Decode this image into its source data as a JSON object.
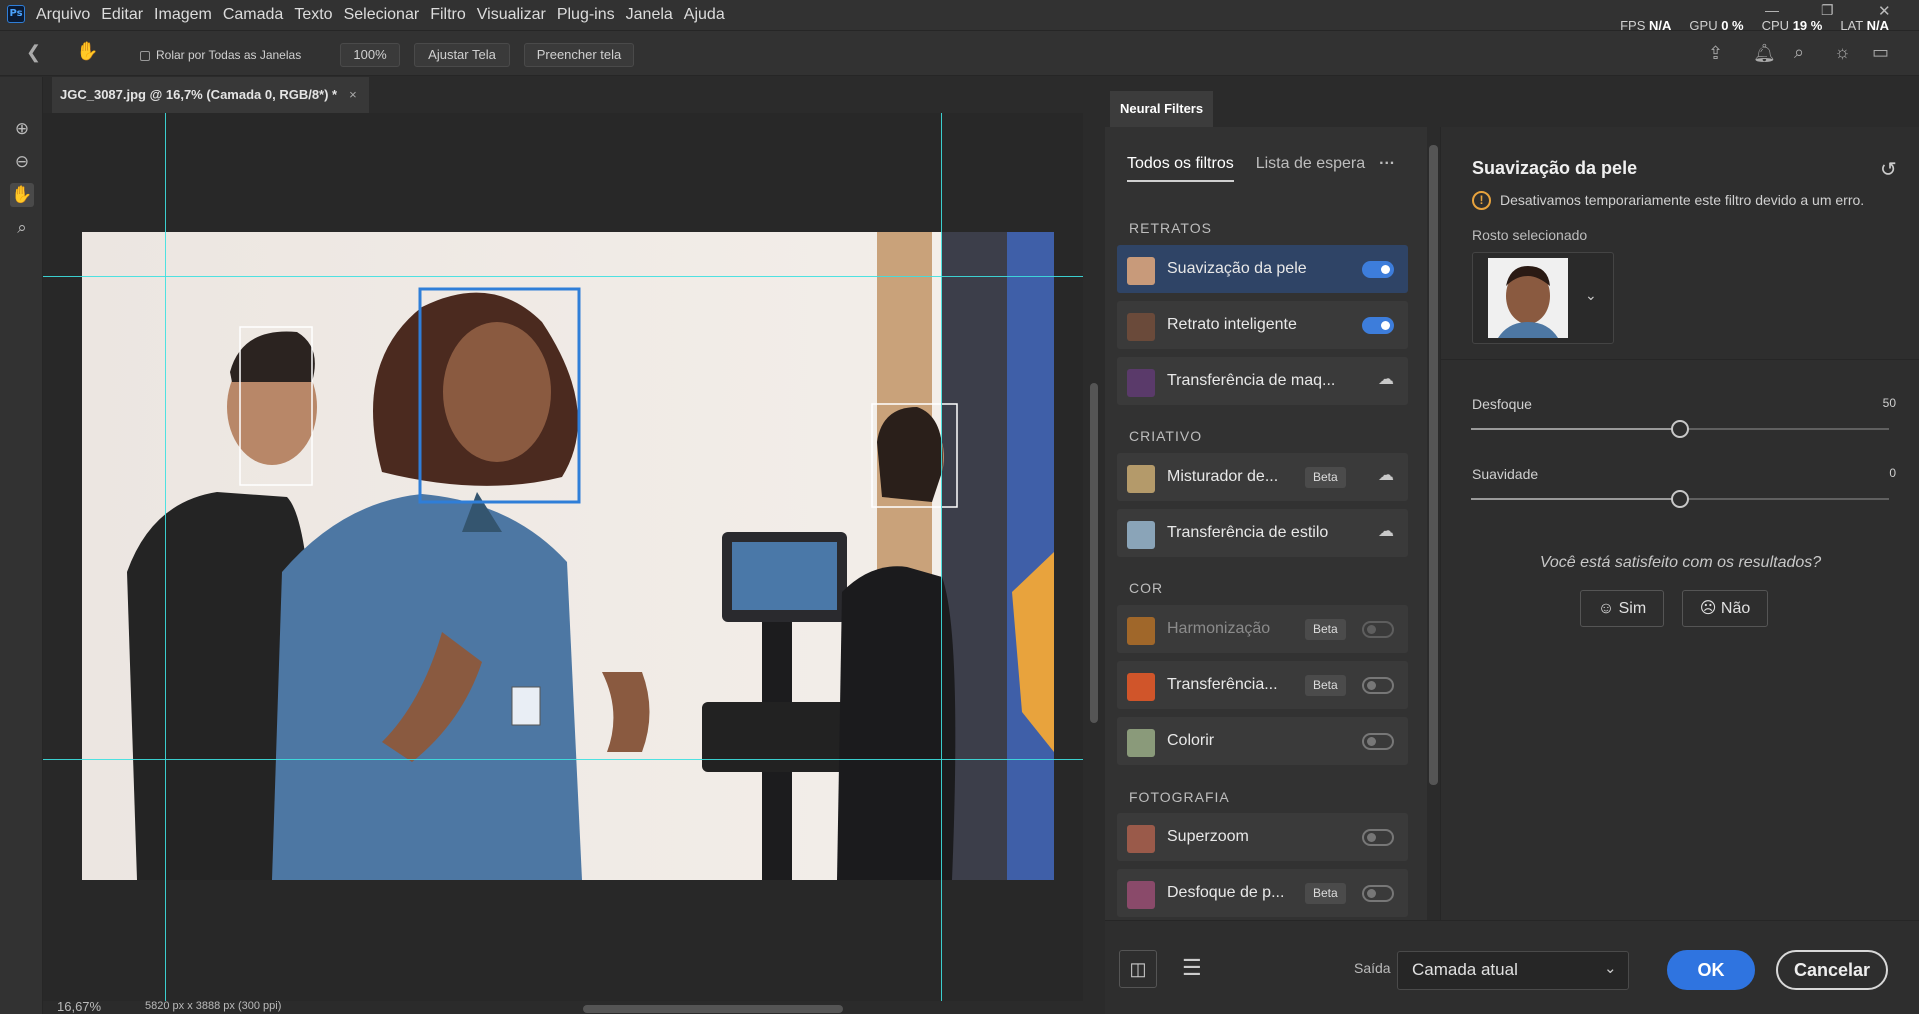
{
  "app": {
    "logo_text": "Ps"
  },
  "menu": [
    "Arquivo",
    "Editar",
    "Imagem",
    "Camada",
    "Texto",
    "Selecionar",
    "Filtro",
    "Visualizar",
    "Plug-ins",
    "Janela",
    "Ajuda"
  ],
  "perf": {
    "fps_label": "FPS",
    "fps_value": "N/A",
    "gpu_label": "GPU",
    "gpu_value": "0 %",
    "cpu_label": "CPU",
    "cpu_value": "19 %",
    "lat_label": "LAT",
    "lat_value": "N/A"
  },
  "options": {
    "scroll_all": "Rolar por Todas as Janelas",
    "zoom": "100%",
    "fit": "Ajustar Tela",
    "fill": "Preencher tela"
  },
  "document": {
    "tab_title": "JGC_3087.jpg @ 16,7% (Camada 0, RGB/8*) *",
    "close": "×"
  },
  "status": {
    "zoom": "16,67%",
    "info": "5820 px x 3888 px (300 ppi)"
  },
  "neural": {
    "panel_title": "Neural Filters",
    "tabs": {
      "all": "Todos os filtros",
      "waitlist": "Lista de espera",
      "more": "···"
    },
    "sections": {
      "portraits": "RETRATOS",
      "creative": "CRIATIVO",
      "color": "COR",
      "photo": "FOTOGRAFIA"
    },
    "beta": "Beta",
    "filters": [
      {
        "label": "Suavização da pele",
        "state": "on"
      },
      {
        "label": "Retrato inteligente",
        "state": "on"
      },
      {
        "label": "Transferência de maq...",
        "state": "cloud"
      },
      {
        "label": "Misturador de...",
        "state": "cloud"
      },
      {
        "label": "Transferência de estilo",
        "state": "cloud"
      },
      {
        "label": "Harmonização",
        "state": "off"
      },
      {
        "label": "Transferência...",
        "state": "off"
      },
      {
        "label": "Colorir",
        "state": "off"
      },
      {
        "label": "Superzoom",
        "state": "off"
      },
      {
        "label": "Desfoque de p...",
        "state": "off"
      }
    ],
    "detail": {
      "title": "Suavização da pele",
      "warning": "Desativamos temporariamente este filtro devido a um erro.",
      "face_label": "Rosto selecionado",
      "blur_label": "Desfoque",
      "blur_value": "50",
      "smooth_label": "Suavidade",
      "smooth_value": "0",
      "satisfied": "Você está satisfeito com os resultados?",
      "yes": "Sim",
      "no": "Não"
    },
    "footer": {
      "output_label": "Saída",
      "output_value": "Camada atual",
      "ok": "OK",
      "cancel": "Cancelar"
    }
  },
  "colors": {
    "accent": "#3d7ddb",
    "selected_row": "#2f4466",
    "guide": "#3de0e0",
    "warning": "#e8a33d"
  }
}
